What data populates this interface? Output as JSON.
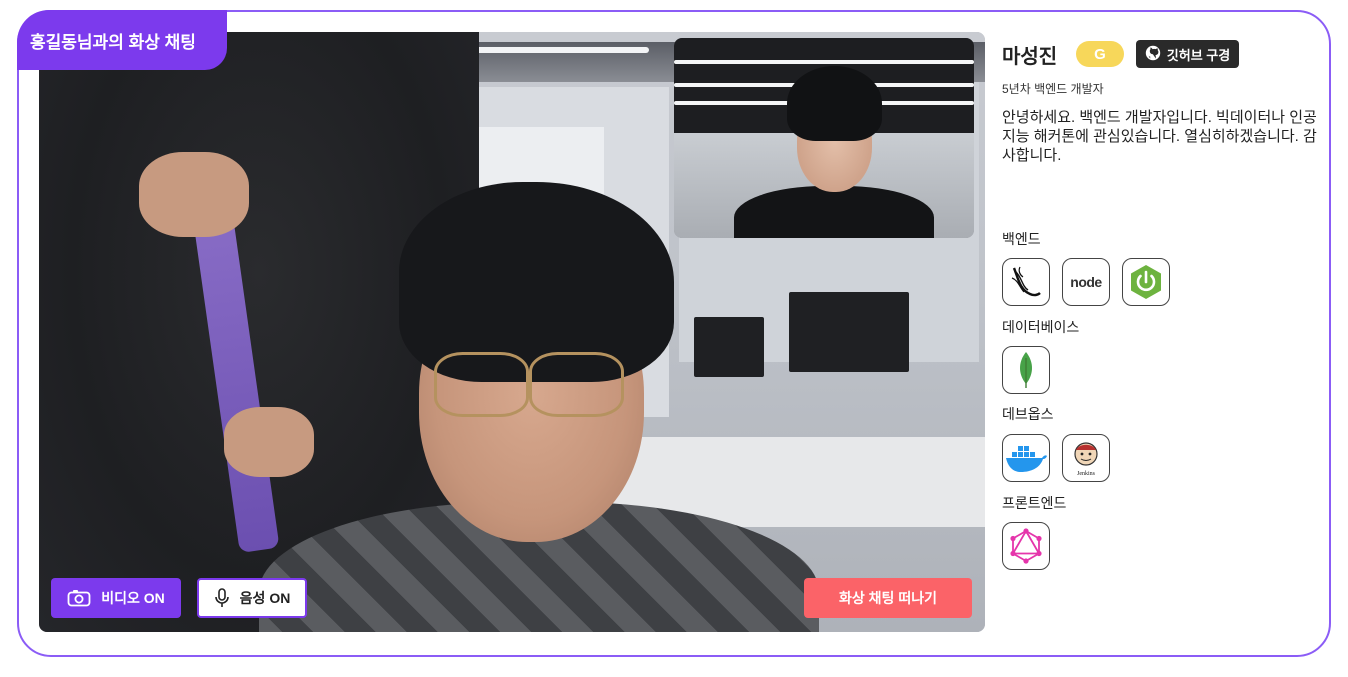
{
  "session": {
    "title": "홍길동님과의 화상 채팅"
  },
  "controls": {
    "video_label": "비디오 ON",
    "audio_label": "음성 ON",
    "leave_label": "화상 채팅 떠나기"
  },
  "profile": {
    "name": "마성진",
    "badge": "G",
    "github_label": "깃허브 구경",
    "subtitle": "5년차 백엔드 개발자",
    "intro": "안녕하세요. 백엔드 개발자입니다. 빅데이터나 인공지능 해커톤에 관심있습니다. 열심히하겠습니다. 감사합니다."
  },
  "skills": [
    {
      "category": "백엔드",
      "items": [
        "flask-icon",
        "nodejs-icon",
        "spring-icon"
      ]
    },
    {
      "category": "데이터베이스",
      "items": [
        "mongodb-icon"
      ]
    },
    {
      "category": "데브옵스",
      "items": [
        "docker-icon",
        "jenkins-icon"
      ]
    },
    {
      "category": "프론트엔드",
      "items": [
        "graphql-icon"
      ]
    }
  ],
  "icon_text": {
    "node": "node",
    "jenkins": "Jenkins"
  },
  "colors": {
    "accent": "#7c3aed",
    "leave": "#fb6368",
    "badge": "#f7d75a",
    "github": "#2a2a2a"
  }
}
